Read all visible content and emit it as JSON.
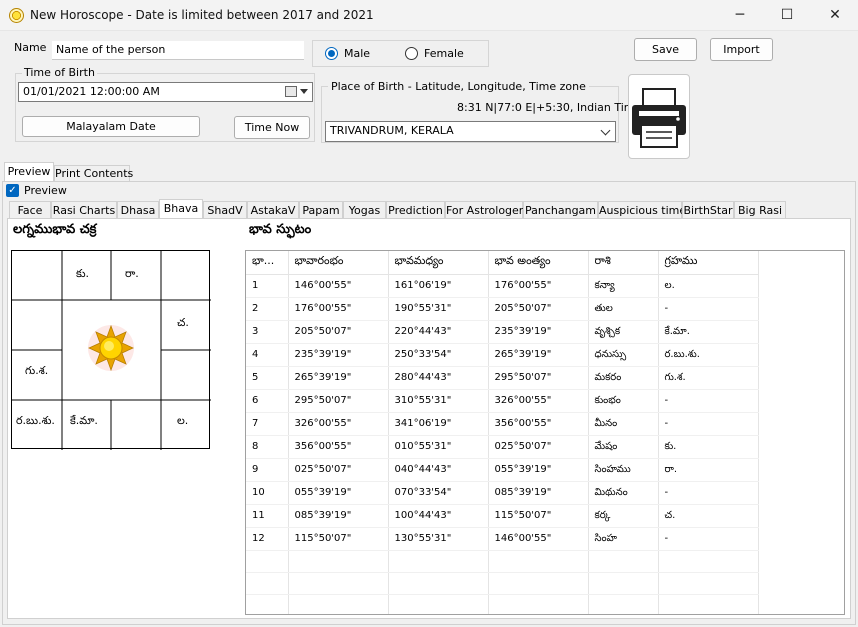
{
  "window": {
    "title": "New Horoscope - Date is limited between 2017 and 2021",
    "minimize": "─",
    "maximize": "☐",
    "close": "✕"
  },
  "form": {
    "name_label": "Name",
    "name_value": "Name of the person",
    "gender": {
      "male": "Male",
      "female": "Female",
      "selected": "Male"
    },
    "save_label": "Save",
    "import_label": "Import",
    "time_of_birth_label": "Time of Birth",
    "datetime_value": "01/01/2021  12:00:00 AM",
    "malayalam_date_label": "Malayalam Date",
    "time_now_label": "Time Now",
    "place_label": "Place of Birth - Latitude, Longitude, Time zone",
    "coordinates": "8:31 N|77:0 E|+5:30, Indian Time",
    "place_value": "TRIVANDRUM, KERALA"
  },
  "outer_tabs": [
    "Preview",
    "Print Contents"
  ],
  "preview_checkbox": {
    "label": "Preview",
    "checked": true
  },
  "inner_tabs": [
    "Face",
    "Rasi Charts",
    "Dhasa",
    "Bhava",
    "ShadV",
    "AstakaV",
    "Papam",
    "Yogas",
    "Prediction",
    "For Astrologer",
    "Panchangam",
    "Auspicious time",
    "BirthStar",
    "Big Rasi"
  ],
  "active_inner_tab": "Bhava",
  "chart": {
    "title": "లగ్నముభావ చక్ర",
    "cells": {
      "r0c1": "కు.",
      "r0c2": "రా.",
      "r1c3": "చ.",
      "r2c0": "గు.శ.",
      "r3c0": "ర.బు.శు.",
      "r3c1": "కే.మా.",
      "r3c3": "ల."
    },
    "center_icon": "sun-icon"
  },
  "table": {
    "title": "భావ స్ఫుటం",
    "columns": [
      "భా...",
      "భావారంభం",
      "భావమధ్యం",
      "భావ అంత్యం",
      "రాశి",
      "గ్రహము"
    ],
    "rows": [
      [
        "1",
        "146°00'55\"",
        "161°06'19\"",
        "176°00'55\"",
        "కన్యా",
        "ల."
      ],
      [
        "2",
        "176°00'55\"",
        "190°55'31\"",
        "205°50'07\"",
        "తుల",
        "-"
      ],
      [
        "3",
        "205°50'07\"",
        "220°44'43\"",
        "235°39'19\"",
        "వృశ్చిక",
        "కే.మా."
      ],
      [
        "4",
        "235°39'19\"",
        "250°33'54\"",
        "265°39'19\"",
        "ధనుస్సు",
        "ర.బు.శు."
      ],
      [
        "5",
        "265°39'19\"",
        "280°44'43\"",
        "295°50'07\"",
        "మకరం",
        "గు.శ."
      ],
      [
        "6",
        "295°50'07\"",
        "310°55'31\"",
        "326°00'55\"",
        "కుంభం",
        "-"
      ],
      [
        "7",
        "326°00'55\"",
        "341°06'19\"",
        "356°00'55\"",
        "మీనం",
        "-"
      ],
      [
        "8",
        "356°00'55\"",
        "010°55'31\"",
        "025°50'07\"",
        "మేషం",
        "కు."
      ],
      [
        "9",
        "025°50'07\"",
        "040°44'43\"",
        "055°39'19\"",
        "సింహము",
        "రా."
      ],
      [
        "10",
        "055°39'19\"",
        "070°33'54\"",
        "085°39'19\"",
        "మిథునం",
        "-"
      ],
      [
        "11",
        "085°39'19\"",
        "100°44'43\"",
        "115°50'07\"",
        "కర్క",
        "చ."
      ],
      [
        "12",
        "115°50'07\"",
        "130°55'31\"",
        "146°00'55\"",
        "సింహ",
        "-"
      ]
    ]
  },
  "colors": {
    "accent": "#0067c0",
    "sun": "#ffd400",
    "sun_ray": "#e0a200"
  }
}
